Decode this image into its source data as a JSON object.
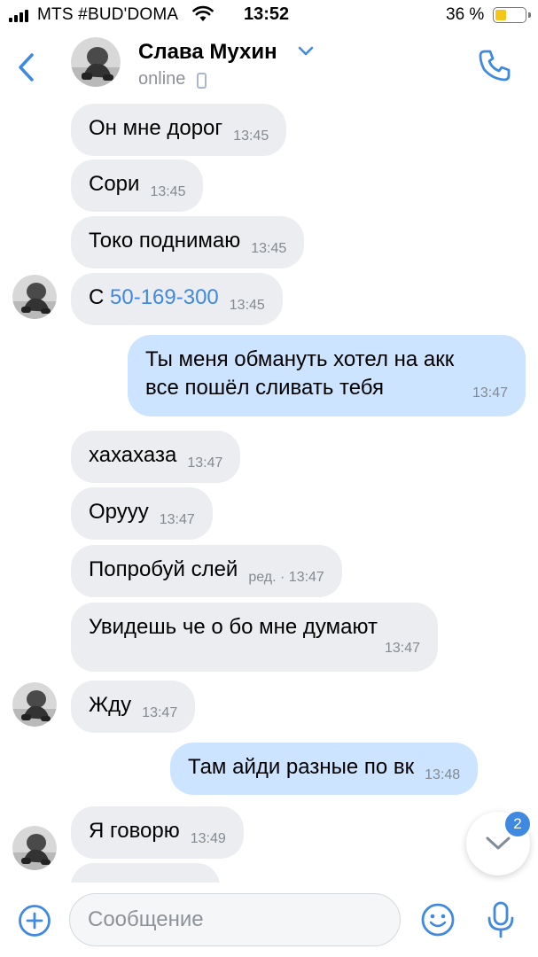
{
  "status_bar": {
    "carrier": "MTS #BUD'DOMA",
    "time": "13:52",
    "battery": "36 %"
  },
  "header": {
    "contact_name": "Слава Мухин",
    "status": "online",
    "icons": [
      "back-icon",
      "chevron-down-icon",
      "mobile-device-icon",
      "phone-icon"
    ]
  },
  "messages": [
    {
      "dir": "in",
      "text": "Он мне дорог",
      "time": "13:45"
    },
    {
      "dir": "in",
      "text": "Сори",
      "time": "13:45"
    },
    {
      "dir": "in",
      "text": "Токо поднимаю",
      "time": "13:45"
    },
    {
      "dir": "in",
      "prefix": "С ",
      "link": "50-169-300",
      "time": "13:45"
    },
    {
      "dir": "out",
      "line1": "Ты меня обмануть хотел на акк",
      "line2": "все пошёл сливать тебя",
      "time": "13:47"
    },
    {
      "dir": "in",
      "text": "хахахаза",
      "time": "13:47"
    },
    {
      "dir": "in",
      "text": "Оруyy",
      "time": "13:47"
    },
    {
      "dir": "in",
      "text": "Попробуй слей",
      "time": "ред. · 13:47"
    },
    {
      "dir": "in",
      "text": "Увидешь че о бо мне думают",
      "time": "13:47"
    },
    {
      "dir": "in",
      "text": "Жду",
      "time": "13:47"
    },
    {
      "dir": "out",
      "text": "Там айди разные по вк",
      "time": "13:48"
    },
    {
      "dir": "in",
      "text": "Я говорю",
      "time": "13:49"
    }
  ],
  "scroll_down": {
    "unread_count": "2"
  },
  "composer": {
    "placeholder": "Сообщение",
    "value": ""
  },
  "colors": {
    "accent": "#3f8ae0",
    "incoming_bubble": "#ebedf0",
    "outgoing_bubble": "#cce4ff",
    "time_text": "#858a91"
  }
}
